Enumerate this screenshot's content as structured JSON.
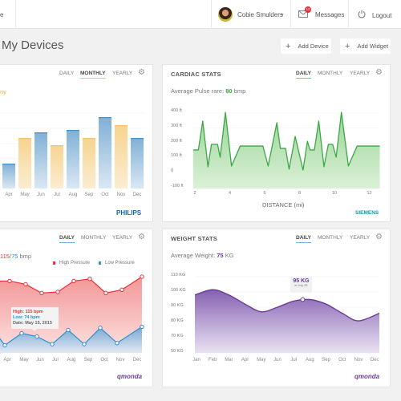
{
  "header": {
    "nav_partial": "e",
    "user_name": "Cobie Smulders",
    "messages_label": "Messages",
    "messages_badge": "12",
    "logout_label": "Logout"
  },
  "page": {
    "title": "My Devices",
    "add_device": "Add Device",
    "add_widget": "Add Widget"
  },
  "tabs": {
    "daily": "DAILY",
    "monthly": "MONTHLY",
    "yearly": "YEARLY"
  },
  "colors": {
    "blue": "#4a90c8",
    "orange": "#f3c26b",
    "green": "#3aa845",
    "red": "#e8303a",
    "lowblue": "#2f8fd0",
    "purple": "#6a3d96",
    "siemens": "#0e9aa7",
    "philips": "#1060b0"
  },
  "activity": {
    "subtitle_partial": "ny",
    "active_tab": "monthly",
    "brand": "PHILIPS",
    "chart_data": {
      "type": "bar",
      "categories": [
        "Apr",
        "May",
        "Jun",
        "Jul",
        "Aug",
        "Sep",
        "Oct",
        "Nov",
        "Dec"
      ],
      "values": [
        31,
        63,
        70,
        54,
        73,
        63,
        89,
        79,
        63
      ],
      "bar_colors": [
        "blue",
        "orange",
        "blue",
        "orange",
        "blue",
        "orange",
        "blue",
        "orange",
        "blue"
      ],
      "grid": true
    }
  },
  "cardiac": {
    "title": "CARDIAC STATS",
    "avg_label": "Average Pulse rare: ",
    "avg_value": "80",
    "avg_unit": " bmp",
    "brand": "SIEMENS",
    "chart_data": {
      "type": "area",
      "xlabel": "DISTANCE (mi)",
      "yticks": [
        "400 ft",
        "300 ft",
        "200 ft",
        "100 ft",
        "0",
        "-100 ft"
      ],
      "xticks": [
        "2",
        "4",
        "6",
        "8",
        "10",
        "12"
      ],
      "ylim": [
        -100,
        400
      ],
      "xlim": [
        1.9,
        12.6
      ],
      "grid": true,
      "points": [
        [
          1.9,
          155
        ],
        [
          2.2,
          155
        ],
        [
          2.45,
          347
        ],
        [
          2.75,
          43
        ],
        [
          2.95,
          192
        ],
        [
          3.3,
          192
        ],
        [
          3.45,
          107
        ],
        [
          3.75,
          405
        ],
        [
          4.1,
          48
        ],
        [
          4.6,
          181
        ],
        [
          5.9,
          181
        ],
        [
          6.2,
          48
        ],
        [
          6.7,
          336
        ],
        [
          6.9,
          165
        ],
        [
          7.2,
          165
        ],
        [
          7.4,
          27
        ],
        [
          7.75,
          245
        ],
        [
          8.2,
          21
        ],
        [
          8.45,
          213
        ],
        [
          8.6,
          155
        ],
        [
          8.85,
          155
        ],
        [
          9.1,
          347
        ],
        [
          9.4,
          43
        ],
        [
          9.65,
          192
        ],
        [
          9.9,
          192
        ],
        [
          10.1,
          107
        ],
        [
          10.4,
          405
        ],
        [
          10.8,
          48
        ],
        [
          11.3,
          181
        ],
        [
          12.6,
          181
        ]
      ]
    }
  },
  "pressure": {
    "avg_high": "115",
    "avg_sep": "/",
    "avg_low": "75",
    "avg_unit": " bmp",
    "brand": "qmonda",
    "tooltip": {
      "high": "High: 115 bpm",
      "low": "Low: 74 bpm",
      "date": "Date: May 15, 2015"
    },
    "chart_data": {
      "type": "line",
      "categories": [
        "Apr",
        "May",
        "Jun",
        "Jul",
        "Aug",
        "Sep",
        "Oct",
        "Nov",
        "Dec"
      ],
      "series": [
        {
          "name": "High Pressure",
          "values": [
            126,
            123,
            115,
            116,
            126,
            128,
            115,
            118,
            130
          ]
        },
        {
          "name": "Low Pressure",
          "values": [
            67,
            78,
            75,
            68,
            81,
            68,
            83,
            69,
            84
          ]
        }
      ]
    }
  },
  "weight": {
    "title": "WEIGHT STATS",
    "avg_label": "Average Weight: ",
    "avg_value": "75",
    "avg_unit": " KG",
    "brand": "qmonda",
    "tooltip": {
      "value": "95 KG",
      "date": "in July 25"
    },
    "chart_data": {
      "type": "area",
      "yticks": [
        "110 KG",
        "100 KG",
        "90 KG",
        "80 KG",
        "70 KG",
        "50 KG"
      ],
      "categories": [
        "Jan",
        "Feb",
        "Mar",
        "Apr",
        "May",
        "Jun",
        "Jul",
        "Aug",
        "Sep",
        "Oct",
        "Nov",
        "Dec"
      ],
      "values": [
        98,
        101.5,
        98,
        92,
        87,
        90,
        94,
        95,
        92,
        86,
        81,
        86
      ],
      "highlight": {
        "month": "Aug",
        "value": 95
      }
    }
  }
}
